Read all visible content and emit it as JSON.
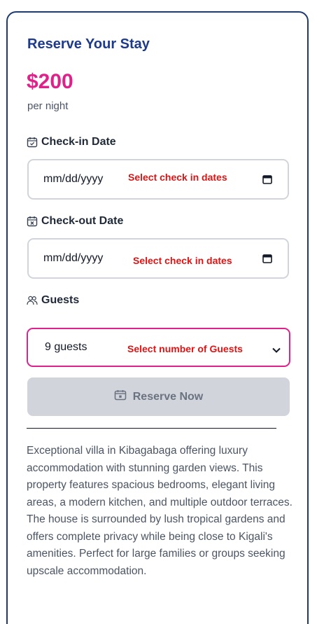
{
  "booking": {
    "title": "Reserve Your Stay",
    "price": "$200",
    "price_unit": "per night",
    "checkin": {
      "label": "Check-in Date",
      "value": "mm/dd/yyyy",
      "hint": "Select check in dates",
      "icon": "calendar-check-icon"
    },
    "checkout": {
      "label": "Check-out Date",
      "value": "mm/dd/yyyy",
      "hint": "Select check in dates",
      "icon": "calendar-x-icon"
    },
    "guests": {
      "label": "Guests",
      "value": "9 guests",
      "hint": "Select number of Guests",
      "icon": "users-icon"
    },
    "reserve_label": "Reserve Now",
    "description": "Exceptional villa in Kibagabaga offering luxury accommodation with stunning garden views. This property features spacious bedrooms, elegant living areas, a modern kitchen, and multiple outdoor terraces. The house is surrounded by lush tropical gardens and offers complete privacy while being close to Kigali's amenities. Perfect for large families or groups seeking upscale accommodation."
  },
  "colors": {
    "title": "#1e3a8a",
    "price": "#e0218a",
    "card_border": "#1e3a6e",
    "hint": "#dc1414",
    "select_border": "#e0218a",
    "button_bg": "#d1d5db",
    "button_text": "#6b7280"
  }
}
